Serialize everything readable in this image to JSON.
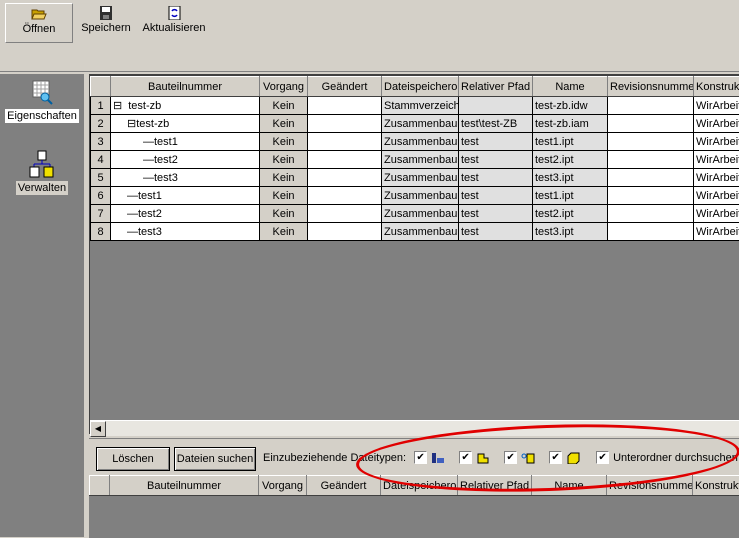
{
  "toolbar": {
    "open": "Öffnen",
    "save": "Speichern",
    "refresh": "Aktualisieren"
  },
  "sidebar": {
    "properties": "Eigenschaften",
    "manage": "Verwalten"
  },
  "columns": [
    "",
    "Bauteilnummer",
    "Vorgang",
    "Geändert",
    "Dateispeicherort",
    "Relativer Pfad",
    "Name",
    "Revisionsnummer",
    "Konstruktion"
  ],
  "rows": [
    {
      "num": "1",
      "part": "test-zb",
      "depth": 0,
      "expander": "⊟",
      "action": "Kein",
      "changed": "",
      "location": "Stammverzeichnis",
      "path": "",
      "name": "test-zb.idw",
      "rev": "",
      "design": "WirArbeiten"
    },
    {
      "num": "2",
      "part": "test-zb",
      "depth": 1,
      "expander": "⊟",
      "action": "Kein",
      "changed": "",
      "location": "Zusammenbau",
      "path": "test\\test-ZB",
      "name": "test-zb.iam",
      "rev": "",
      "design": "WirArbeiten"
    },
    {
      "num": "3",
      "part": "test1",
      "depth": 2,
      "expander": "",
      "action": "Kein",
      "changed": "",
      "location": "Zusammenbau",
      "path": "test",
      "name": "test1.ipt",
      "rev": "",
      "design": "WirArbeiten"
    },
    {
      "num": "4",
      "part": "test2",
      "depth": 2,
      "expander": "",
      "action": "Kein",
      "changed": "",
      "location": "Zusammenbau",
      "path": "test",
      "name": "test2.ipt",
      "rev": "",
      "design": "WirArbeiten"
    },
    {
      "num": "5",
      "part": "test3",
      "depth": 2,
      "expander": "",
      "action": "Kein",
      "changed": "",
      "location": "Zusammenbau",
      "path": "test",
      "name": "test3.ipt",
      "rev": "",
      "design": "WirArbeiten"
    },
    {
      "num": "6",
      "part": "test1",
      "depth": 1,
      "expander": "",
      "action": "Kein",
      "changed": "",
      "location": "Zusammenbau",
      "path": "test",
      "name": "test1.ipt",
      "rev": "",
      "design": "WirArbeiten"
    },
    {
      "num": "7",
      "part": "test2",
      "depth": 1,
      "expander": "",
      "action": "Kein",
      "changed": "",
      "location": "Zusammenbau",
      "path": "test",
      "name": "test2.ipt",
      "rev": "",
      "design": "WirArbeiten"
    },
    {
      "num": "8",
      "part": "test3",
      "depth": 1,
      "expander": "",
      "action": "Kein",
      "changed": "",
      "location": "Zusammenbau",
      "path": "test",
      "name": "test3.ipt",
      "rev": "",
      "design": "WirArbeiten"
    }
  ],
  "lower": {
    "delete": "Löschen",
    "search": "Dateien suchen",
    "filetypes_label": "Einzubeziehende Dateitypen:",
    "subfolders": "Unterordner durchsuchen",
    "check": "✔"
  },
  "filetypes": [
    "drawing",
    "assembly",
    "presentation",
    "part"
  ],
  "colors": {
    "annotation": "#e00000"
  }
}
